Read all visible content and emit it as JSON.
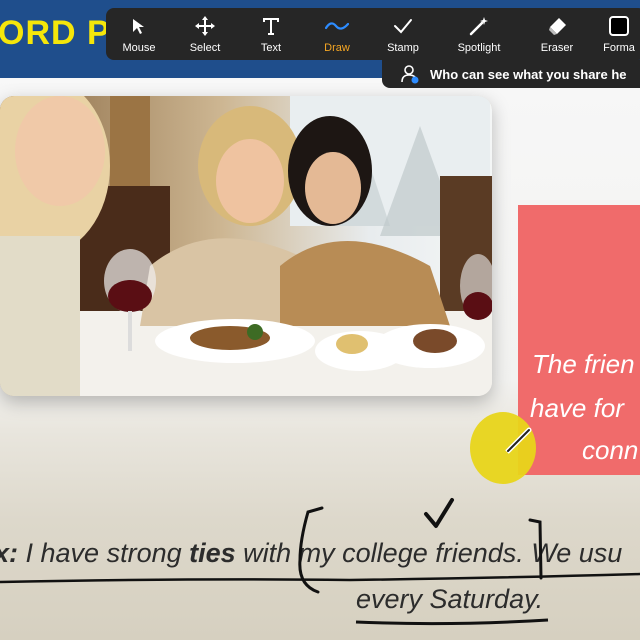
{
  "slide": {
    "title": "ORD P",
    "note_lines": [
      "The frien",
      "have for",
      "conn"
    ],
    "example": {
      "prefix": "x:",
      "text_before": " I have strong ",
      "bold_word": "ties",
      "text_after": " with my college friends. We usu",
      "line2": "every Saturday."
    }
  },
  "toolbar": {
    "tools": [
      {
        "label": "Mouse",
        "icon": "cursor-arrow-icon"
      },
      {
        "label": "Select",
        "icon": "move-arrows-icon"
      },
      {
        "label": "Text",
        "icon": "text-T-icon"
      },
      {
        "label": "Draw",
        "icon": "wave-line-icon",
        "active": true
      },
      {
        "label": "Stamp",
        "icon": "checkmark-icon"
      },
      {
        "label": "Spotlight",
        "icon": "magic-wand-icon"
      },
      {
        "label": "Eraser",
        "icon": "eraser-icon"
      },
      {
        "label": "Forma",
        "icon": "format-square-icon"
      }
    ],
    "active_color": "#f5a623"
  },
  "share_banner": {
    "text": "Who can see what you share he",
    "icon": "person-viewer-icon"
  }
}
